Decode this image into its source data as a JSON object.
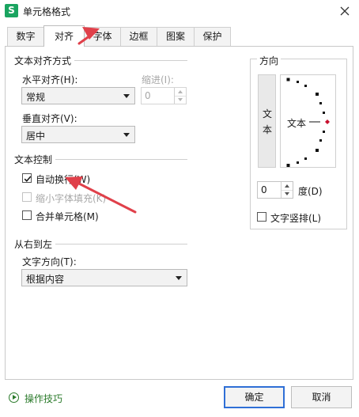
{
  "window": {
    "title": "单元格格式",
    "app_icon": "S"
  },
  "tabs": [
    {
      "label": "数字",
      "active": false
    },
    {
      "label": "对齐",
      "active": true
    },
    {
      "label": "字体",
      "active": false
    },
    {
      "label": "边框",
      "active": false
    },
    {
      "label": "图案",
      "active": false
    },
    {
      "label": "保护",
      "active": false
    }
  ],
  "text_alignment": {
    "group_title": "文本对齐方式",
    "horizontal_label": "水平对齐(H):",
    "horizontal_value": "常规",
    "indent_label": "缩进(I):",
    "indent_value": "0",
    "vertical_label": "垂直对齐(V):",
    "vertical_value": "居中"
  },
  "text_control": {
    "group_title": "文本控制",
    "wrap_label": "自动换行(W)",
    "wrap_checked": true,
    "shrink_label": "缩小字体填充(K)",
    "shrink_checked": false,
    "merge_label": "合并单元格(M)",
    "merge_checked": false
  },
  "rtl": {
    "group_title": "从右到左",
    "direction_label": "文字方向(T):",
    "direction_value": "根据内容"
  },
  "orientation": {
    "group_title": "方向",
    "vertical_text_char1": "文",
    "vertical_text_char2": "本",
    "dial_text": "文本",
    "degree_value": "0",
    "degree_label": "度(D)",
    "vertical_stack_label": "文字竖排(L)",
    "vertical_stack_checked": false
  },
  "footer": {
    "tips_label": "操作技巧",
    "ok_label": "确定",
    "cancel_label": "取消"
  },
  "colors": {
    "app_icon_bg": "#1aa460",
    "annotation_arrow": "#e0404a",
    "primary_border": "#2f6fd6",
    "dial_marker_active": "#c8102e",
    "tips_text": "#2a7a2a"
  }
}
